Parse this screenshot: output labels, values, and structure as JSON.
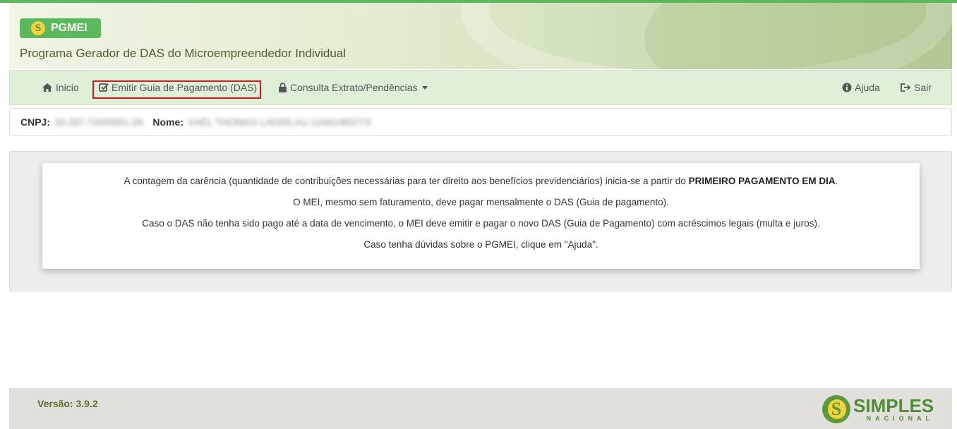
{
  "header": {
    "logo_text": "PGMEI",
    "logo_icon": "simples-s-icon",
    "subtitle": "Programa Gerador de DAS do Microempreendedor Individual"
  },
  "nav": {
    "inicio": "Inicio",
    "emitir": "Emitir Guia de Pagamento (DAS)",
    "consulta": "Consulta Extrato/Pendências",
    "ajuda": "Ajuda",
    "sair": "Sair",
    "icons": {
      "inicio": "home-icon",
      "emitir": "check-square-icon",
      "consulta": "lock-icon",
      "ajuda": "info-circle-icon",
      "sair": "logout-icon"
    }
  },
  "ident": {
    "cnpj_label": "CNPJ:",
    "cnpj_value": "33.337.720/0001-29",
    "nome_label": "Nome:",
    "nome_value": "XAEL THOMAS LADISLAU 12441483773"
  },
  "notice": {
    "line1_prefix": "A contagem da carência (quantidade de contribuições necessárias para ter direito aos benefícios previdenciários) inicia-se a partir do ",
    "line1_bold": "PRIMEIRO PAGAMENTO EM DIA",
    "line1_suffix": ".",
    "line2": "O MEI, mesmo sem faturamento, deve pagar mensalmente o DAS (Guia de pagamento).",
    "line3": "Caso o DAS não tenha sido pago até a data de vencimento, o MEI deve emitir e pagar o novo DAS (Guia de Pagamento) com acréscimos legais (multa e juros).",
    "line4": "Caso tenha dúvidas sobre o PGMEI, clique em \"Ajuda\"."
  },
  "footer": {
    "version": "Versão: 3.9.2",
    "logo_text": "SIMPLES",
    "logo_subtext": "NACIONAL"
  },
  "colors": {
    "accent_green": "#5cb85c",
    "navbar_bg": "#dfefd8",
    "highlight_red": "#e0161b"
  }
}
